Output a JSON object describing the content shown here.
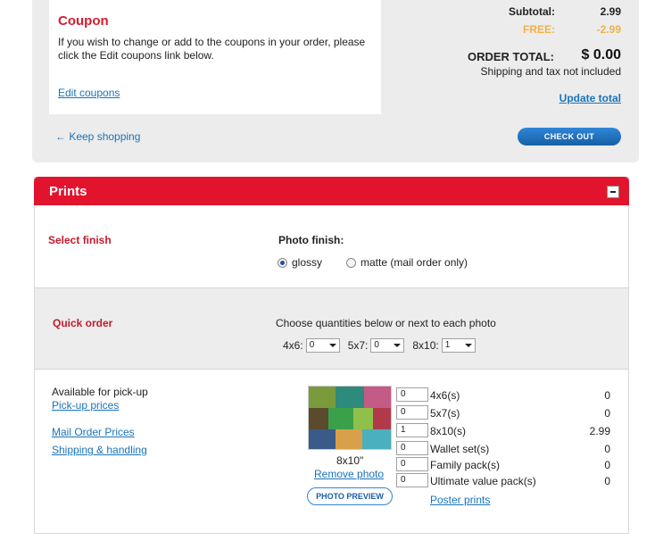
{
  "coupon": {
    "title": "Coupon",
    "text": "If you wish to change or add to the coupons in your order, please click the Edit coupons link below.",
    "edit_link": "Edit coupons"
  },
  "cart": {
    "keep_shopping": "← Keep shopping",
    "subtotal_label": "Subtotal:",
    "subtotal_value": "2.99",
    "free_label": "FREE:",
    "free_value": "-2.99",
    "order_total_label": "ORDER TOTAL:",
    "order_total_value": "$ 0.00",
    "shipping_note": "Shipping and tax not included",
    "update_total": "Update total",
    "checkout": "CHECK OUT"
  },
  "prints": {
    "title": "Prints",
    "select_finish_label": "Select finish",
    "photo_finish_title": "Photo finish:",
    "finish_options": [
      {
        "label": "glossy",
        "checked": true
      },
      {
        "label": "matte (mail order only)",
        "checked": false
      }
    ],
    "quick_order_label": "Quick order",
    "quick_order_desc": "Choose quantities below or next to each photo",
    "quick_selects": [
      {
        "label": "4x6:",
        "value": "0"
      },
      {
        "label": "5x7:",
        "value": "0"
      },
      {
        "label": "8x10:",
        "value": "1"
      }
    ],
    "available_text": "Available for pick-up",
    "pickup_prices": "Pick-up prices",
    "mail_order_prices": "Mail Order Prices",
    "shipping_handling": "Shipping & handling",
    "photo": {
      "size_caption": "8x10\"",
      "remove": "Remove photo",
      "preview": "PHOTO PREVIEW"
    },
    "quantities": [
      {
        "qty": "0",
        "name": "4x6(s)",
        "price": "0"
      },
      {
        "qty": "0",
        "name": "5x7(s)",
        "price": "0"
      },
      {
        "qty": "1",
        "name": "8x10(s)",
        "price": "2.99"
      },
      {
        "qty": "0",
        "name": "Wallet set(s)",
        "price": "0"
      },
      {
        "qty": "0",
        "name": "Family pack(s)",
        "price": "0"
      },
      {
        "qty": "0",
        "name": "Ultimate value pack(s)",
        "price": "0"
      }
    ],
    "poster_prints": "Poster prints"
  },
  "colors": {
    "brand_red": "#e2142d",
    "label_red": "#c41a2d",
    "link_blue": "#1a73b9",
    "free_orange": "#f0b14a",
    "checkout_blue": "#2f86d6"
  }
}
